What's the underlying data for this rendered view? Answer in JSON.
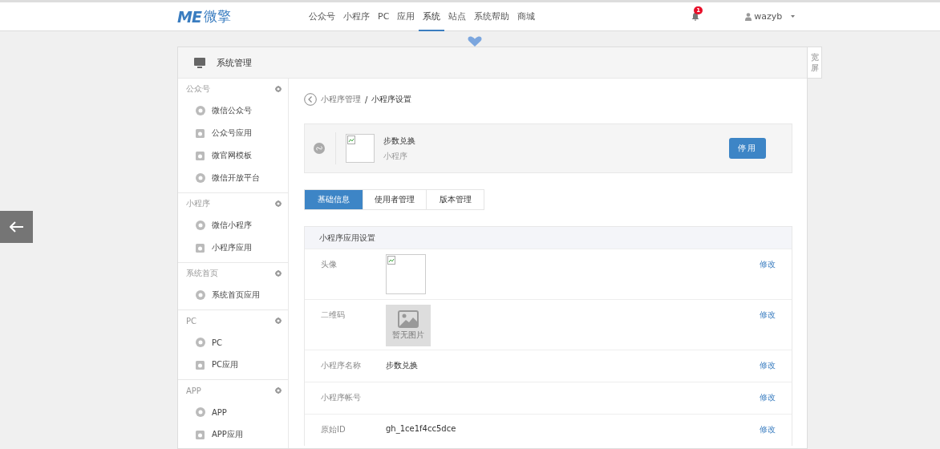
{
  "nav": {
    "logo_mark": "ME",
    "logo_text": "微擎",
    "items": [
      {
        "label": "公众号",
        "selected": false
      },
      {
        "label": "小程序",
        "selected": false
      },
      {
        "label": "PC",
        "selected": false
      },
      {
        "label": "应用",
        "selected": false
      },
      {
        "label": "系统",
        "selected": true
      },
      {
        "label": "站点",
        "selected": false
      },
      {
        "label": "系统帮助",
        "selected": false
      },
      {
        "label": "商城",
        "selected": false
      }
    ],
    "notification_count": "1",
    "user": "wazyb"
  },
  "panel": {
    "title": "系统管理",
    "wide_screen_button": "宽屏"
  },
  "sidebar": {
    "groups": [
      {
        "title": "公众号",
        "items": [
          {
            "label": "微信公众号",
            "kind": "circle"
          },
          {
            "label": "公众号应用",
            "kind": "square"
          },
          {
            "label": "微官网模板",
            "kind": "square"
          },
          {
            "label": "微信开放平台",
            "kind": "circle"
          }
        ]
      },
      {
        "title": "小程序",
        "items": [
          {
            "label": "微信小程序",
            "kind": "circle"
          },
          {
            "label": "小程序应用",
            "kind": "square"
          }
        ]
      },
      {
        "title": "系统首页",
        "items": [
          {
            "label": "系统首页应用",
            "kind": "circle"
          }
        ]
      },
      {
        "title": "PC",
        "items": [
          {
            "label": "PC",
            "kind": "circle"
          },
          {
            "label": "PC应用",
            "kind": "square"
          }
        ]
      },
      {
        "title": "APP",
        "items": [
          {
            "label": "APP",
            "kind": "circle"
          },
          {
            "label": "APP应用",
            "kind": "square"
          }
        ]
      }
    ]
  },
  "breadcrumb": {
    "parent": "小程序管理",
    "separator": "/",
    "current": "小程序设置"
  },
  "app_card": {
    "name": "步数兑换",
    "type": "小程序",
    "button": "停用"
  },
  "tabs": [
    {
      "label": "基础信息",
      "selected": true
    },
    {
      "label": "使用者管理",
      "selected": false
    },
    {
      "label": "版本管理",
      "selected": false
    }
  ],
  "settings": {
    "title": "小程序应用设置",
    "rows": [
      {
        "label": "头像",
        "kind": "image",
        "action": "修改"
      },
      {
        "label": "二维码",
        "kind": "placeholder",
        "value": "暂无图片",
        "action": "修改"
      },
      {
        "label": "小程序名称",
        "kind": "text",
        "value": "步数兑换",
        "action": "修改"
      },
      {
        "label": "小程序帐号",
        "kind": "text",
        "action": "修改"
      },
      {
        "label": "原始ID",
        "kind": "text",
        "value": "gh_1ce1f4cc5dce",
        "action": "修改"
      }
    ]
  }
}
